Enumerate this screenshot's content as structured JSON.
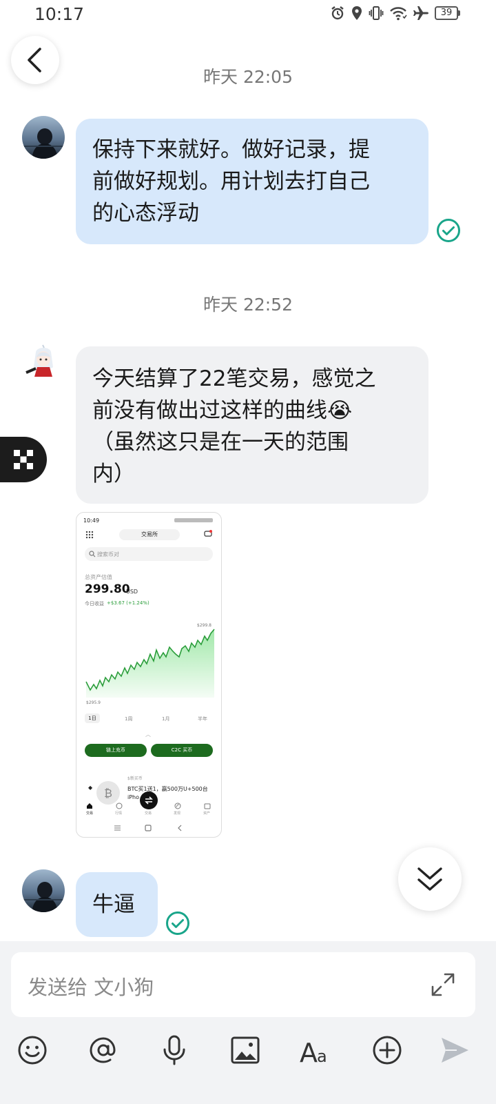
{
  "status_bar": {
    "time": "10:17",
    "battery": "39",
    "icons": [
      "alarm-icon",
      "location-icon",
      "vibrate-icon",
      "wifi-icon",
      "airplane-icon",
      "battery-icon"
    ]
  },
  "conversation": {
    "timestamps": [
      "昨天 22:05",
      "昨天 22:52"
    ],
    "messages": [
      {
        "sender": "self",
        "lines": [
          "保持下来就好。做好记录，提",
          "前做好规划。用计划去打自己",
          "的心态浮动"
        ],
        "status": "read-check-icon"
      },
      {
        "sender": "other",
        "lines": [
          "今天结算了22笔交易，感觉之",
          "前没有做出过这样的曲线😭",
          "（虽然这只是在一天的范围",
          "内）"
        ]
      },
      {
        "sender": "other",
        "type": "image"
      },
      {
        "sender": "self",
        "lines": [
          "牛逼"
        ],
        "status": "read-check-icon"
      }
    ]
  },
  "image_message": {
    "time": "10:49",
    "exchange_tab": "交易所",
    "search_placeholder": "搜索币对",
    "asset_label": "总资产估值",
    "asset_value": "299.80",
    "asset_unit": "USD",
    "pnl_label": "今日收益",
    "pnl_value": "+$3.67 (+1.24%)",
    "chart_high": "$299.8",
    "chart_low": "$295.9",
    "ranges": [
      "1日",
      "1周",
      "1月",
      "半年"
    ],
    "buttons": [
      "链上充币",
      "C2C 买币"
    ],
    "promo_title": "$新买币",
    "promo_text": "BTC买1送1，赢500万U+500台",
    "promo_text2": "iPho",
    "nav": [
      "交易",
      "行情",
      "交易",
      "发现",
      "资产"
    ],
    "colors": {
      "green": "#2a9d3a",
      "dark_green": "#1d6b1f"
    }
  },
  "composer": {
    "placeholder": "发送给 文小狗"
  },
  "toolbar_icons": [
    "emoji-icon",
    "mention-icon",
    "microphone-icon",
    "image-icon",
    "text-format-icon",
    "plus-icon",
    "send-icon"
  ],
  "colors": {
    "self_bubble": "#d7e8fb",
    "other_bubble": "#f0f1f3",
    "check": "#19a58a",
    "background": "#ffffff"
  }
}
